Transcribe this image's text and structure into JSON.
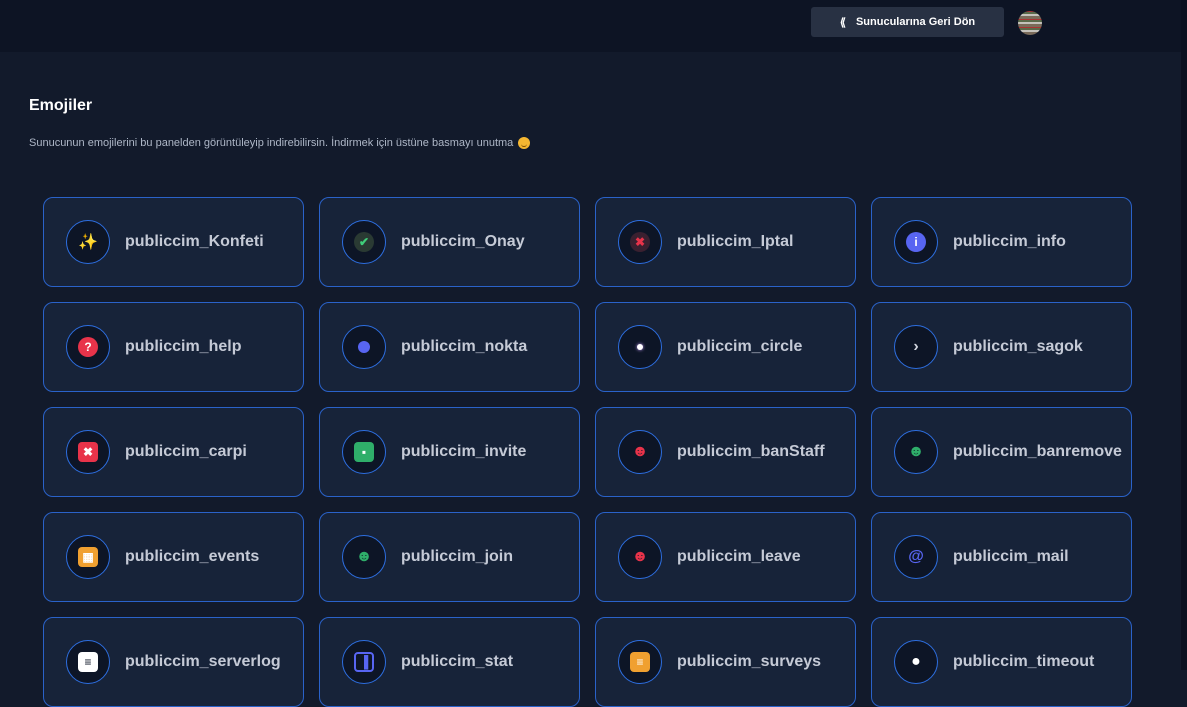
{
  "header": {
    "back_button_label": "Sunucularına Geri Dön",
    "back_icon": "double-chevron-left-icon"
  },
  "page": {
    "title": "Emojiler",
    "description": "Sunucunun emojilerini bu panelden görüntüleyip indirebilirsin. İndirmek için üstüne basmayı unutma"
  },
  "emojis": [
    {
      "name": "publiccim_Konfeti",
      "icon": "confetti-icon",
      "color": "#c89a5a"
    },
    {
      "name": "publiccim_Onay",
      "icon": "checkmark-icon",
      "color": "#2f9e5a"
    },
    {
      "name": "publiccim_Iptal",
      "icon": "cross-icon",
      "color": "#e8334a"
    },
    {
      "name": "publiccim_info",
      "icon": "info-icon",
      "color": "#5865f2"
    },
    {
      "name": "publiccim_help",
      "icon": "help-icon",
      "color": "#e8334a"
    },
    {
      "name": "publiccim_nokta",
      "icon": "dot-icon",
      "color": "#5865f2"
    },
    {
      "name": "publiccim_circle",
      "icon": "small-circle-icon",
      "color": "#c9a0ff"
    },
    {
      "name": "publiccim_sagok",
      "icon": "right-arrow-icon",
      "color": "#d0d4dd"
    },
    {
      "name": "publiccim_carpi",
      "icon": "x-square-icon",
      "color": "#e8334a"
    },
    {
      "name": "publiccim_invite",
      "icon": "invite-icon",
      "color": "#2fae6a"
    },
    {
      "name": "publiccim_banStaff",
      "icon": "user-ban-icon",
      "color": "#e8334a"
    },
    {
      "name": "publiccim_banremove",
      "icon": "user-unban-icon",
      "color": "#2fae6a"
    },
    {
      "name": "publiccim_events",
      "icon": "calendar-icon",
      "color": "#f0a030"
    },
    {
      "name": "publiccim_join",
      "icon": "user-join-icon",
      "color": "#2fae6a"
    },
    {
      "name": "publiccim_leave",
      "icon": "user-leave-icon",
      "color": "#e8334a"
    },
    {
      "name": "publiccim_mail",
      "icon": "at-sign-icon",
      "color": "#5865f2"
    },
    {
      "name": "publiccim_serverlog",
      "icon": "log-icon",
      "color": "#ffffff"
    },
    {
      "name": "publiccim_stat",
      "icon": "stat-icon",
      "color": "#5865f2"
    },
    {
      "name": "publiccim_surveys",
      "icon": "survey-icon",
      "color": "#f0a030"
    },
    {
      "name": "publiccim_timeout",
      "icon": "user-timeout-icon",
      "color": "#ffffff"
    }
  ]
}
